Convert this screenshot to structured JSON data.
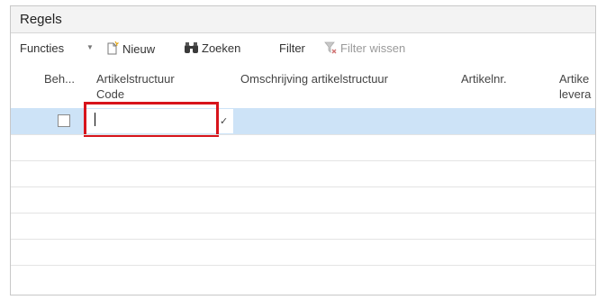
{
  "panel": {
    "title": "Regels"
  },
  "toolbar": {
    "functions": "Functies",
    "new": "Nieuw",
    "search": "Zoeken",
    "filter": "Filter",
    "clear_filter": "Filter wissen"
  },
  "columns": {
    "beh": "Beh...",
    "code_line1": "Artikelstructuur",
    "code_line2": "Code",
    "description": "Omschrijving artikelstructuur",
    "itemno": "Artikelnr.",
    "supplier_line1": "Artike",
    "supplier_line2": "levera"
  },
  "row": {
    "checked": false,
    "code_value": ""
  },
  "colors": {
    "selection": "#cde3f7",
    "highlight": "#d7141c"
  }
}
